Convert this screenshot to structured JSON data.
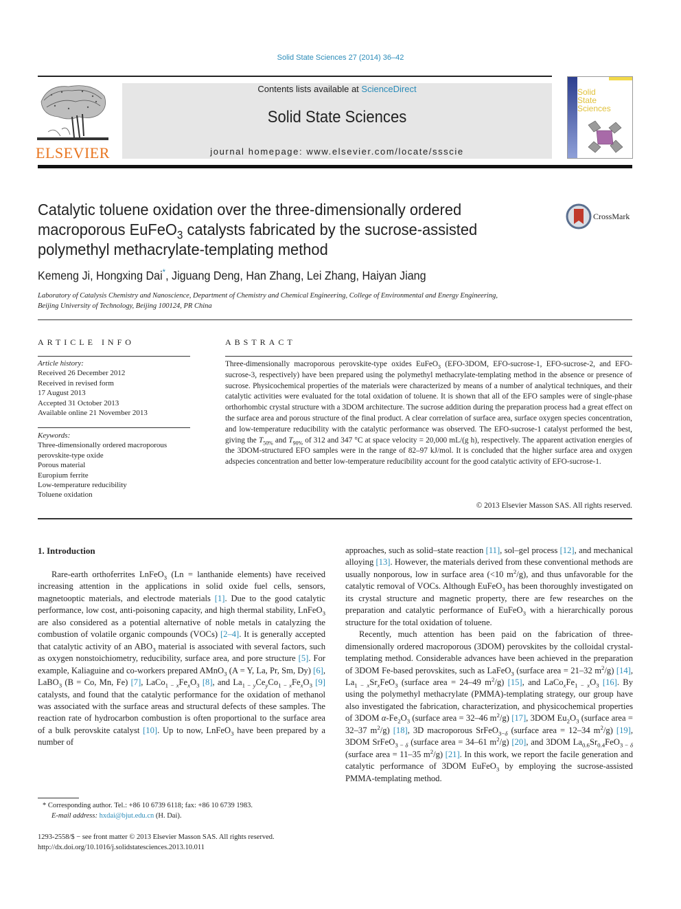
{
  "header": {
    "citation": "Solid State Sciences 27 (2014) 36–42",
    "contents_prefix": "Contents lists available at ",
    "contents_link": "ScienceDirect",
    "journal_name": "Solid State Sciences",
    "homepage": "journal homepage: www.elsevier.com/locate/ssscie",
    "publisher_logo_text": "ELSEVIER",
    "cover": {
      "line1": "Solid",
      "line2": "State",
      "line3": "Sciences"
    }
  },
  "article": {
    "title_line1": "Catalytic toluene oxidation over the three-dimensionally ordered",
    "title_line2_a": "macroporous EuFeO",
    "title_line2_sub": "3",
    "title_line2_b": " catalysts fabricated by the sucrose-assisted",
    "title_line3": "polymethyl methacrylate-templating method",
    "crossmark_label": "CrossMark",
    "authors_a": "Kemeng Ji, Hongxing Dai",
    "authors_star": "*",
    "authors_b": ", Jiguang Deng, Han Zhang, Lei Zhang, Haiyan Jiang",
    "affiliation_line1": "Laboratory of Catalysis Chemistry and Nanoscience, Department of Chemistry and Chemical Engineering, College of Environmental and Energy Engineering,",
    "affiliation_line2": "Beijing University of Technology, Beijing 100124, PR China"
  },
  "article_info": {
    "heading": "ARTICLE INFO",
    "history_label": "Article history:",
    "history": [
      "Received 26 December 2012",
      "Received in revised form",
      "17 August 2013",
      "Accepted 31 October 2013",
      "Available online 21 November 2013"
    ],
    "keywords_label": "Keywords:",
    "keywords": [
      "Three-dimensionally ordered macroporous",
      "perovskite-type oxide",
      "Porous material",
      "Europium ferrite",
      "Low-temperature reducibility",
      "Toluene oxidation"
    ]
  },
  "abstract": {
    "heading": "ABSTRACT",
    "p1": "Three-dimensionally macroporous perovskite-type oxides EuFeO",
    "p1_sub": "3",
    "p2": " (EFO-3DOM, EFO-sucrose-1, EFO-sucrose-2, and EFO-sucrose-3, respectively) have been prepared using the polymethyl methacrylate-templating method in the absence or presence of sucrose. Physicochemical properties of the materials were characterized by means of a number of analytical techniques, and their catalytic activities were evaluated for the total oxidation of toluene. It is shown that all of the EFO samples were of single-phase orthorhombic crystal structure with a 3DOM architecture. The sucrose addition during the preparation process had a great effect on the surface area and porous structure of the final product. A clear correlation of surface area, surface oxygen species concentration, and low-temperature reducibility with the catalytic performance was observed. The EFO-sucrose-1 catalyst performed the best, giving the ",
    "t50": "T",
    "t50_sub": "50%",
    "and": " and ",
    "t90": "T",
    "t90_sub": "90%",
    "p3": " of 312 and 347 °C at space velocity = 20,000 mL/(g h), respectively. The apparent activation energies of the 3DOM-structured EFO samples were in the range of 82–97 kJ/mol. It is concluded that the higher surface area and oxygen adspecies concentration and better low-temperature reducibility account for the good catalytic activity of EFO-sucrose-1.",
    "copyright": "© 2013 Elsevier Masson SAS. All rights reserved."
  },
  "introduction": {
    "heading": "1.  Introduction",
    "left_html": "<p>Rare-earth orthoferrites LnFeO<sub>3</sub> (Ln = lanthanide elements) have received increasing attention in the applications in solid oxide fuel cells, sensors, magnetooptic materials, and electrode materials <span class=\"link\">[1]</span>. Due to the good catalytic performance, low cost, anti-poisoning capacity, and high thermal stability, LnFeO<sub>3</sub> are also considered as a potential alternative of noble metals in catalyzing the combustion of volatile organic compounds (VOCs) <span class=\"link\">[2–4]</span>. It is generally accepted that catalytic activity of an ABO<sub>3</sub> material is associated with several factors, such as oxygen nonstoichiometry, reducibility, surface area, and pore structure <span class=\"link\">[5]</span>. For example, Kaliaguine and co-workers prepared AMnO<sub>3</sub> (A = Y, La, Pr, Sm, Dy) <span class=\"link\">[6]</span>, LaBO<sub>3</sub> (B = Co, Mn, Fe) <span class=\"link\">[7]</span>, LaCo<sub>1 − <i>x</i></sub>Fe<sub><i>x</i></sub>O<sub>3</sub> <span class=\"link\">[8]</span>, and La<sub>1 − <i>y</i></sub>Ce<sub><i>y</i></sub>Co<sub>1 − <i>x</i></sub>Fe<sub><i>x</i></sub>O<sub>3</sub> <span class=\"link\">[9]</span> catalysts, and found that the catalytic performance for the oxidation of methanol was associated with the surface areas and structural defects of these samples. The reaction rate of hydrocarbon combustion is often proportional to the surface area of a bulk perovskite catalyst <span class=\"link\">[10]</span>. Up to now, LnFeO<sub>3</sub> have been prepared by a number of</p>",
    "right_html": "<p class=\"noindent\">approaches, such as solid–state reaction <span class=\"link\">[11]</span>, sol–gel process <span class=\"link\">[12]</span>, and mechanical alloying <span class=\"link\">[13]</span>. However, the materials derived from these conventional methods are usually nonporous, low in surface area (&lt;10 m<sup>2</sup>/g), and thus unfavorable for the catalytic removal of VOCs. Although EuFeO<sub>3</sub> has been thoroughly investigated on its crystal structure and magnetic property, there are few researches on the preparation and catalytic performance of EuFeO<sub>3</sub> with a hierarchically porous structure for the total oxidation of toluene.</p><p>Recently, much attention has been paid on the fabrication of three-dimensionally ordered macroporous (3DOM) perovskites by the colloidal crystal-templating method. Considerable advances have been achieved in the preparation of 3DOM Fe-based perovskites, such as LaFeO<sub>3</sub> (surface area = 21–32 m<sup>2</sup>/g) <span class=\"link\">[14]</span>, La<sub>1 − <i>x</i></sub>Sr<sub><i>x</i></sub>FeO<sub>3</sub> (surface area = 24–49 m<sup>2</sup>/g) <span class=\"link\">[15]</span>, and LaCo<sub><i>x</i></sub>Fe<sub>1 − <i>x</i></sub>O<sub>3</sub> <span class=\"link\">[16]</span>. By using the polymethyl methacrylate (PMMA)-templating strategy, our group have also investigated the fabrication, characterization, and physicochemical properties of 3DOM <i>α</i>-Fe<sub>2</sub>O<sub>3</sub> (surface area = 32–46 m<sup>2</sup>/g) <span class=\"link\">[17]</span>, 3DOM Eu<sub>2</sub>O<sub>3</sub> (surface area = 32–37 m<sup>2</sup>/g) <span class=\"link\">[18]</span>, 3D macroporous SrFeO<sub>3−<i>δ</i></sub> (surface area = 12–34 m<sup>2</sup>/g) <span class=\"link\">[19]</span>, 3DOM SrFeO<sub>3 − <i>δ</i></sub> (surface area = 34–61 m<sup>2</sup>/g) <span class=\"link\">[20]</span>, and 3DOM La<sub>0.6</sub>Sr<sub>0.4</sub>FeO<sub>3 − <i>δ</i></sub> (surface area = 11–35 m<sup>2</sup>/g) <span class=\"link\">[21]</span>. In this work, we report the facile generation and catalytic performance of 3DOM EuFeO<sub>3</sub> by employing the sucrose-assisted PMMA-templating method.</p>"
  },
  "footnotes": {
    "star": "*",
    "corresponding": " Corresponding author. Tel.: +86 10 6739 6118; fax: +86 10 6739 1983.",
    "email_label": "E-mail address: ",
    "email": "hxdai@bjut.edu.cn",
    "email_suffix": " (H. Dai).",
    "issn_line": "1293-2558/$ − see front matter © 2013 Elsevier Masson SAS. All rights reserved.",
    "doi": "http://dx.doi.org/10.1016/j.solidstatesciences.2013.10.011"
  },
  "colors": {
    "link": "#2a8bb8",
    "elsevier_orange": "#e8741e",
    "header_band": "#e6e6e6"
  }
}
